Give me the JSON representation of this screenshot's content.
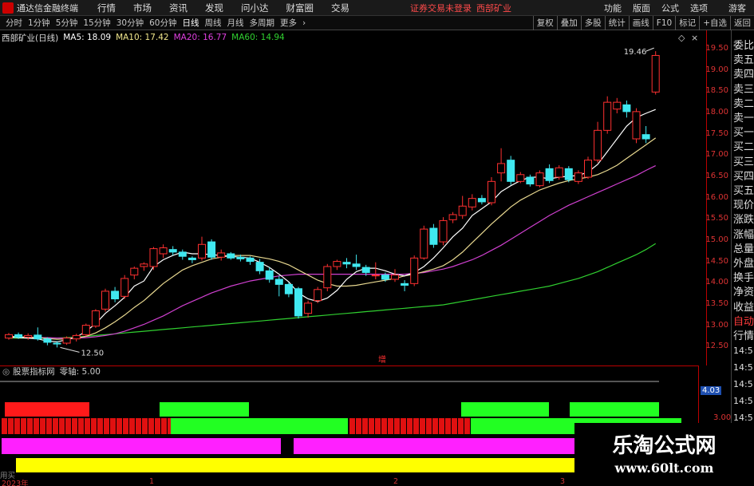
{
  "topbar": {
    "app_title": "通达信金融终端",
    "menus": [
      "行情",
      "市场",
      "资讯",
      "发现",
      "问小达",
      "财富圈",
      "交易"
    ],
    "login_status": "证券交易未登录",
    "stock_name": "西部矿业",
    "right_items": [
      "功能",
      "版面",
      "公式",
      "选项"
    ],
    "guest": "游客"
  },
  "periodbar": {
    "periods": [
      "分时",
      "1分钟",
      "5分钟",
      "15分钟",
      "30分钟",
      "60分钟",
      "日线",
      "周线",
      "月线",
      "多周期",
      "更多"
    ],
    "active": "日线",
    "tools": [
      "复权",
      "叠加",
      "多股",
      "统计",
      "画线",
      "F10",
      "标记",
      "+自选",
      "返回"
    ]
  },
  "chart_header": {
    "title": "西部矿业(日线)",
    "ma": [
      {
        "label": "MA5: 18.09",
        "color": "#ffffff"
      },
      {
        "label": "MA10: 17.42",
        "color": "#f0e68c"
      },
      {
        "label": "MA20: 16.77",
        "color": "#e040e0"
      },
      {
        "label": "MA60: 14.94",
        "color": "#30d030"
      }
    ]
  },
  "chart_data": {
    "type": "candlestick",
    "ylim": [
      12.3,
      19.8
    ],
    "y_ticks": [
      "19.50",
      "19.00",
      "18.50",
      "18.00",
      "17.50",
      "17.00",
      "16.50",
      "16.00",
      "15.50",
      "15.00",
      "14.50",
      "14.00",
      "13.50",
      "13.00",
      "12.50"
    ],
    "high_label": "19.46",
    "low_label": "12.50",
    "center_mark": "增",
    "candles": [
      [
        12.72,
        12.8,
        12.68,
        12.84
      ],
      [
        12.8,
        12.74,
        12.7,
        12.85
      ],
      [
        12.74,
        12.78,
        12.68,
        12.83
      ],
      [
        12.79,
        12.7,
        12.66,
        12.97
      ],
      [
        12.7,
        12.62,
        12.55,
        12.74
      ],
      [
        12.6,
        12.58,
        12.5,
        12.65
      ],
      [
        12.6,
        12.72,
        12.56,
        12.76
      ],
      [
        12.7,
        12.78,
        12.64,
        12.82
      ],
      [
        12.8,
        13.02,
        12.76,
        13.06
      ],
      [
        13.0,
        13.36,
        12.96,
        13.4
      ],
      [
        13.4,
        13.82,
        13.34,
        13.88
      ],
      [
        13.82,
        13.64,
        13.56,
        13.92
      ],
      [
        13.7,
        14.12,
        13.64,
        14.2
      ],
      [
        14.2,
        14.36,
        14.1,
        14.4
      ],
      [
        14.4,
        14.46,
        14.3,
        14.5
      ],
      [
        14.4,
        14.82,
        14.32,
        14.86
      ],
      [
        14.7,
        14.84,
        14.6,
        14.92
      ],
      [
        14.8,
        14.74,
        14.66,
        14.88
      ],
      [
        14.74,
        14.64,
        14.56,
        14.8
      ],
      [
        14.6,
        14.56,
        14.48,
        14.64
      ],
      [
        14.6,
        14.92,
        14.54,
        15.1
      ],
      [
        14.98,
        14.62,
        14.56,
        15.04
      ],
      [
        14.62,
        14.72,
        14.54,
        14.8
      ],
      [
        14.7,
        14.6,
        14.56,
        14.74
      ],
      [
        14.62,
        14.58,
        14.52,
        14.68
      ],
      [
        14.6,
        14.52,
        14.44,
        14.64
      ],
      [
        14.5,
        14.3,
        14.22,
        14.58
      ],
      [
        14.3,
        14.1,
        14.02,
        14.38
      ],
      [
        14.1,
        13.98,
        13.7,
        14.18
      ],
      [
        13.98,
        13.76,
        13.68,
        14.02
      ],
      [
        13.88,
        13.24,
        13.18,
        13.92
      ],
      [
        13.3,
        13.54,
        13.2,
        13.6
      ],
      [
        13.6,
        13.86,
        13.54,
        13.92
      ],
      [
        13.9,
        14.4,
        13.82,
        14.46
      ],
      [
        14.4,
        14.52,
        14.32,
        14.56
      ],
      [
        14.5,
        14.46,
        14.36,
        14.6
      ],
      [
        14.46,
        14.4,
        14.32,
        14.68
      ],
      [
        14.38,
        14.26,
        14.18,
        14.44
      ],
      [
        14.2,
        14.2,
        14.1,
        14.5
      ],
      [
        14.2,
        14.1,
        14.04,
        14.26
      ],
      [
        14.1,
        14.2,
        14.04,
        14.34
      ],
      [
        14.0,
        13.96,
        13.82,
        14.08
      ],
      [
        14.0,
        14.6,
        13.94,
        14.66
      ],
      [
        14.6,
        15.28,
        14.56,
        15.36
      ],
      [
        15.3,
        14.92,
        14.84,
        15.4
      ],
      [
        14.98,
        15.48,
        14.9,
        15.56
      ],
      [
        15.5,
        15.62,
        15.42,
        15.68
      ],
      [
        15.6,
        15.82,
        15.52,
        16.06
      ],
      [
        15.8,
        16.0,
        15.72,
        16.1
      ],
      [
        16.0,
        15.92,
        15.86,
        16.08
      ],
      [
        15.9,
        16.4,
        15.84,
        16.5
      ],
      [
        16.6,
        16.82,
        16.4,
        17.18
      ],
      [
        16.9,
        16.4,
        16.32,
        17.0
      ],
      [
        16.4,
        16.56,
        16.36,
        16.62
      ],
      [
        16.5,
        16.34,
        16.28,
        16.56
      ],
      [
        16.3,
        16.6,
        16.26,
        16.66
      ],
      [
        16.7,
        16.42,
        16.36,
        16.8
      ],
      [
        16.5,
        16.72,
        16.44,
        16.78
      ],
      [
        16.7,
        16.44,
        16.38,
        16.76
      ],
      [
        16.4,
        16.6,
        16.34,
        16.66
      ],
      [
        16.5,
        16.9,
        16.46,
        16.98
      ],
      [
        16.9,
        17.6,
        16.84,
        17.8
      ],
      [
        17.6,
        18.26,
        17.52,
        18.4
      ],
      [
        18.1,
        18.26,
        18.0,
        18.36
      ],
      [
        18.2,
        18.04,
        17.9,
        18.3
      ],
      [
        17.4,
        18.04,
        17.3,
        18.12
      ],
      [
        17.5,
        17.4,
        17.3,
        17.7
      ],
      [
        18.5,
        19.36,
        18.44,
        19.46
      ]
    ],
    "ma5": [
      12.75,
      12.73,
      12.72,
      12.7,
      12.65,
      12.63,
      12.68,
      12.74,
      12.88,
      13.06,
      13.3,
      13.48,
      13.68,
      13.94,
      14.06,
      14.4,
      14.56,
      14.66,
      14.74,
      14.7,
      14.7,
      14.68,
      14.66,
      14.64,
      14.62,
      14.6,
      14.5,
      14.38,
      14.22,
      14.04,
      13.78,
      13.64,
      13.58,
      13.66,
      13.84,
      14.1,
      14.28,
      14.36,
      14.36,
      14.3,
      14.22,
      14.18,
      14.26,
      14.4,
      14.6,
      14.84,
      15.1,
      15.3,
      15.6,
      15.76,
      15.92,
      16.16,
      16.3,
      16.42,
      16.5,
      16.5,
      16.46,
      16.5,
      16.52,
      16.54,
      16.62,
      16.8,
      17.1,
      17.4,
      17.7,
      17.9,
      18.0,
      18.09
    ],
    "ma10": [
      12.76,
      12.75,
      12.74,
      12.73,
      12.71,
      12.69,
      12.7,
      12.72,
      12.76,
      12.84,
      12.96,
      13.1,
      13.26,
      13.44,
      13.6,
      13.8,
      14.0,
      14.16,
      14.32,
      14.42,
      14.5,
      14.58,
      14.62,
      14.66,
      14.66,
      14.66,
      14.62,
      14.58,
      14.52,
      14.44,
      14.32,
      14.2,
      14.08,
      14.0,
      13.94,
      13.94,
      13.96,
      14.0,
      14.04,
      14.08,
      14.12,
      14.18,
      14.22,
      14.28,
      14.34,
      14.42,
      14.56,
      14.74,
      14.96,
      15.18,
      15.4,
      15.6,
      15.8,
      15.96,
      16.08,
      16.2,
      16.28,
      16.36,
      16.42,
      16.46,
      16.5,
      16.56,
      16.66,
      16.78,
      16.94,
      17.1,
      17.26,
      17.42
    ],
    "ma20": [
      12.74,
      12.74,
      12.74,
      12.73,
      12.73,
      12.72,
      12.72,
      12.72,
      12.73,
      12.75,
      12.78,
      12.82,
      12.88,
      12.96,
      13.04,
      13.14,
      13.24,
      13.36,
      13.48,
      13.58,
      13.68,
      13.78,
      13.86,
      13.94,
      14.0,
      14.06,
      14.1,
      14.14,
      14.18,
      14.2,
      14.22,
      14.22,
      14.22,
      14.22,
      14.22,
      14.22,
      14.22,
      14.22,
      14.22,
      14.22,
      14.22,
      14.22,
      14.24,
      14.26,
      14.3,
      14.34,
      14.4,
      14.48,
      14.56,
      14.66,
      14.78,
      14.9,
      15.04,
      15.18,
      15.32,
      15.46,
      15.6,
      15.72,
      15.84,
      15.94,
      16.04,
      16.14,
      16.24,
      16.34,
      16.44,
      16.54,
      16.66,
      16.77
    ],
    "ma60": [
      12.72,
      12.72,
      12.72,
      12.72,
      12.72,
      12.72,
      12.73,
      12.74,
      12.76,
      12.78,
      12.8,
      12.82,
      12.84,
      12.86,
      12.88,
      12.9,
      12.92,
      12.94,
      12.96,
      12.98,
      13.0,
      13.02,
      13.04,
      13.06,
      13.08,
      13.1,
      13.12,
      13.14,
      13.16,
      13.18,
      13.2,
      13.22,
      13.24,
      13.26,
      13.28,
      13.3,
      13.32,
      13.34,
      13.36,
      13.38,
      13.4,
      13.42,
      13.44,
      13.46,
      13.48,
      13.5,
      13.54,
      13.58,
      13.62,
      13.66,
      13.7,
      13.74,
      13.78,
      13.82,
      13.86,
      13.9,
      13.94,
      14.0,
      14.06,
      14.12,
      14.2,
      14.28,
      14.38,
      14.48,
      14.58,
      14.68,
      14.8,
      14.94
    ]
  },
  "indicator": {
    "title": "股票指标网",
    "zero_axis": "零轴: 5.00",
    "axis_top": "4.03",
    "axis_mid": "3.00",
    "rows": [
      {
        "color": "#ff1a1a",
        "segments": [
          [
            0,
            112
          ],
          [
            578,
            688
          ],
          [
            714,
            826
          ]
        ],
        "alt_color": "#22ff22",
        "alt_segments": [
          [
            200,
            312
          ],
          [
            578,
            688
          ],
          [
            714,
            826
          ]
        ]
      },
      {
        "label": "red-striped-row"
      }
    ]
  },
  "quote_labels": [
    {
      "text": "委比",
      "red": false
    },
    {
      "text": "卖五",
      "red": false
    },
    {
      "text": "卖四",
      "red": false
    },
    {
      "text": "卖三",
      "red": false
    },
    {
      "text": "卖二",
      "red": false
    },
    {
      "text": "卖一",
      "red": false
    },
    {
      "text": "买一",
      "red": false
    },
    {
      "text": "买二",
      "red": false
    },
    {
      "text": "买三",
      "red": false
    },
    {
      "text": "买四",
      "red": false
    },
    {
      "text": "买五",
      "red": false
    },
    {
      "text": "现价",
      "red": false
    },
    {
      "text": "涨跌",
      "red": false
    },
    {
      "text": "涨幅",
      "red": false
    },
    {
      "text": "总量",
      "red": false
    },
    {
      "text": "外盘",
      "red": false
    },
    {
      "text": "换手",
      "red": false
    },
    {
      "text": "净资",
      "red": false
    },
    {
      "text": "收益",
      "red": false
    },
    {
      "text": "自动",
      "red": true
    },
    {
      "text": "行情",
      "red": false
    }
  ],
  "side_times": [
    "14:5",
    "14:5",
    "14:5",
    "14:5",
    "14:5",
    "14:5",
    "14:5",
    "14:5"
  ],
  "time_axis": {
    "year": "2023年",
    "marks": [
      "1",
      "2",
      "3"
    ],
    "left_label": "用买"
  },
  "watermark": {
    "main": "乐淘公式网",
    "url": "www.60lt.com"
  }
}
